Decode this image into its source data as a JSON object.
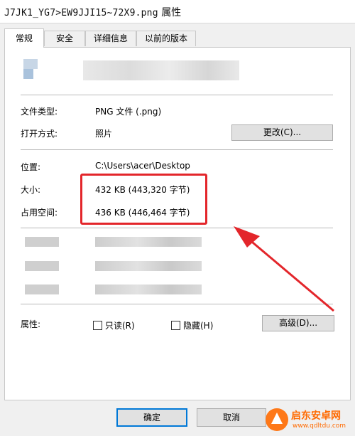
{
  "window": {
    "filename": "J7JK1_YG7>EW9JJI15~72X9.png",
    "title_suffix": "属性"
  },
  "tabs": [
    {
      "label": "常规",
      "active": true
    },
    {
      "label": "安全",
      "active": false
    },
    {
      "label": "详细信息",
      "active": false
    },
    {
      "label": "以前的版本",
      "active": false
    }
  ],
  "general": {
    "file_type_label": "文件类型:",
    "file_type_value": "PNG 文件 (.png)",
    "open_with_label": "打开方式:",
    "open_with_value": "照片",
    "change_button": "更改(C)...",
    "location_label": "位置:",
    "location_value": "C:\\Users\\acer\\Desktop",
    "size_label": "大小:",
    "size_value": "432 KB (443,320 字节)",
    "size_on_disk_label": "占用空间:",
    "size_on_disk_value": "436 KB (446,464 字节)",
    "attributes_label": "属性:",
    "readonly_label": "只读(R)",
    "hidden_label": "隐藏(H)",
    "advanced_button": "高级(D)..."
  },
  "footer": {
    "ok_button": "确定",
    "cancel_button": "取消"
  },
  "watermark": {
    "text_cn": "启东安卓网",
    "text_url": "www.qdltdu.com"
  },
  "colors": {
    "highlight": "#e3262b",
    "accent": "#0078d7",
    "watermark": "#ff6a00"
  }
}
